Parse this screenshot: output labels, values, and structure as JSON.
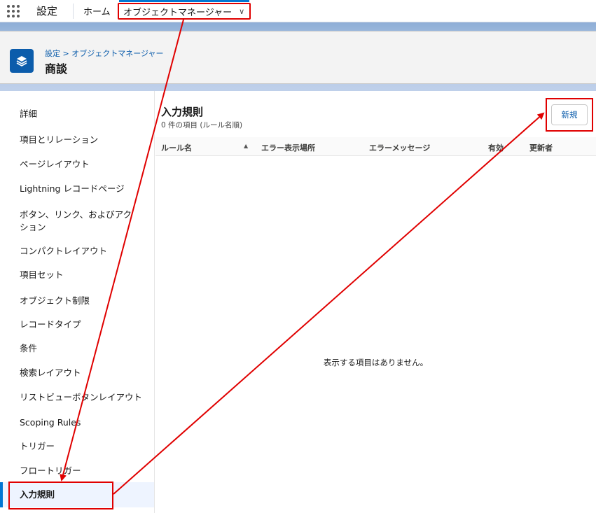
{
  "topbar": {
    "app_name": "設定",
    "home": "ホーム",
    "active_tab": "オブジェクトマネージャー"
  },
  "header": {
    "breadcrumb": "設定 > オブジェクトマネージャー",
    "title": "商談"
  },
  "sidebar": {
    "items": [
      {
        "label": "詳細"
      },
      {
        "label": "項目とリレーション"
      },
      {
        "label": "ページレイアウト"
      },
      {
        "label": "Lightning レコードページ"
      },
      {
        "label": "ボタン、リンク、およびアクション"
      },
      {
        "label": "コンパクトレイアウト"
      },
      {
        "label": "項目セット"
      },
      {
        "label": "オブジェクト制限"
      },
      {
        "label": "レコードタイプ"
      },
      {
        "label": "条件"
      },
      {
        "label": "検索レイアウト"
      },
      {
        "label": "リストビューボタンレイアウト"
      },
      {
        "label": "Scoping Rules"
      },
      {
        "label": "トリガー"
      },
      {
        "label": "フロートリガー"
      },
      {
        "label": "入力規則"
      }
    ],
    "active": "入力規則"
  },
  "content": {
    "title": "入力規則",
    "subtitle": "0 件の項目 (ルール名順)",
    "new_button": "新規",
    "columns": [
      "ルール名",
      "エラー表示場所",
      "エラーメッセージ",
      "有効",
      "更新者"
    ],
    "sort_indicator": "▲",
    "empty_message": "表示する項目はありません。"
  },
  "colors": {
    "brand_blue": "#0176d3",
    "annotation_red": "#e00000",
    "header_icon_bg": "#0b5cab"
  }
}
